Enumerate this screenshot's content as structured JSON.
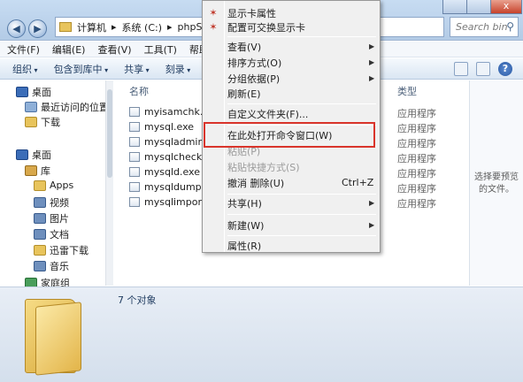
{
  "window": {
    "address_parts": [
      "计算机",
      "系统 (C:)",
      "phpSt"
    ],
    "search_placeholder": "Search bin",
    "close_glyph": "x"
  },
  "menubar": [
    "文件(F)",
    "编辑(E)",
    "查看(V)",
    "工具(T)",
    "帮助(H)"
  ],
  "toolbar": [
    "组织",
    "包含到库中",
    "共享",
    "刻录"
  ],
  "help_glyph": "?",
  "nav": {
    "favorites": [
      "桌面",
      "最近访问的位置",
      "下载"
    ],
    "desktop": "桌面",
    "library": "库",
    "library_items": [
      "Apps",
      "视频",
      "图片",
      "文档",
      "迅雷下载",
      "音乐"
    ],
    "homegroup": "家庭组"
  },
  "filelist": {
    "col_name": "名称",
    "col_type": "类型",
    "files": [
      {
        "name": "myisamchk.exe",
        "type": "应用程序"
      },
      {
        "name": "mysql.exe",
        "type": "应用程序"
      },
      {
        "name": "mysqladmin.exe",
        "type": "应用程序"
      },
      {
        "name": "mysqlcheck.exe",
        "type": "应用程序"
      },
      {
        "name": "mysqld.exe",
        "type": "应用程序"
      },
      {
        "name": "mysqldump.exe",
        "type": "应用程序"
      },
      {
        "name": "mysqlimport.exe",
        "type": "应用程序"
      }
    ]
  },
  "preview_text": "选择要预览的文件。",
  "details": {
    "count": "7 个对象"
  },
  "context_menu": {
    "display_props": "显示卡属性",
    "switch_gpu": "配置可交换显示卡",
    "view": "查看(V)",
    "sort": "排序方式(O)",
    "group": "分组依据(P)",
    "refresh": "刷新(E)",
    "customize": "自定义文件夹(F)...",
    "open_cmd": "在此处打开命令窗口(W)",
    "paste": "粘贴(P)",
    "paste_shortcut": "粘贴快捷方式(S)",
    "undo_delete": "撤消 删除(U)",
    "undo_shortcut": "Ctrl+Z",
    "share": "共享(H)",
    "new": "新建(W)",
    "properties": "属性(R)"
  }
}
